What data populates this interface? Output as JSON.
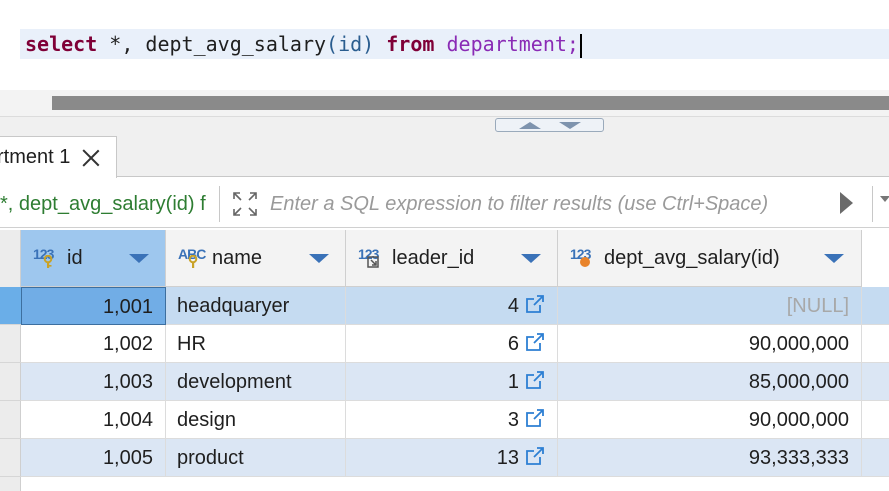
{
  "editor": {
    "keyword_select": "select",
    "select_list_prefix": " *, ",
    "function_name": "dept_avg_salary",
    "function_arg": "(id)",
    "keyword_from": "from",
    "table_name": "department;"
  },
  "results": {
    "tab_label": "rtment 1",
    "filter": {
      "query_text": "*, dept_avg_salary(id) f",
      "placeholder": "Enter a SQL expression to filter results (use Ctrl+Space)"
    },
    "columns": [
      {
        "type_badge": "123",
        "label": "id"
      },
      {
        "type_badge": "ABC",
        "label": "name"
      },
      {
        "type_badge": "123",
        "label": "leader_id"
      },
      {
        "type_badge": "123",
        "label": "dept_avg_salary(id)"
      }
    ],
    "rows": [
      {
        "id": "1,001",
        "name": "headquaryer",
        "leader_id": "4",
        "dept_avg_salary": "[NULL]"
      },
      {
        "id": "1,002",
        "name": "HR",
        "leader_id": "6",
        "dept_avg_salary": "90,000,000"
      },
      {
        "id": "1,003",
        "name": "development",
        "leader_id": "1",
        "dept_avg_salary": "85,000,000"
      },
      {
        "id": "1,004",
        "name": "design",
        "leader_id": "3",
        "dept_avg_salary": "90,000,000"
      },
      {
        "id": "1,005",
        "name": "product",
        "leader_id": "13",
        "dept_avg_salary": "93,333,333"
      }
    ]
  },
  "colors": {
    "keyword": "#7f0037",
    "identifier": "#8a2bb5",
    "selection": "#71ade6",
    "alt_row": "#dbe6f4",
    "type_badge": "#3a72b8"
  },
  "icons": [
    "close-icon",
    "expand-icon",
    "run-filter-icon",
    "link-icon",
    "sort-arrow-icon",
    "key-icon",
    "type-badge-icon"
  ]
}
